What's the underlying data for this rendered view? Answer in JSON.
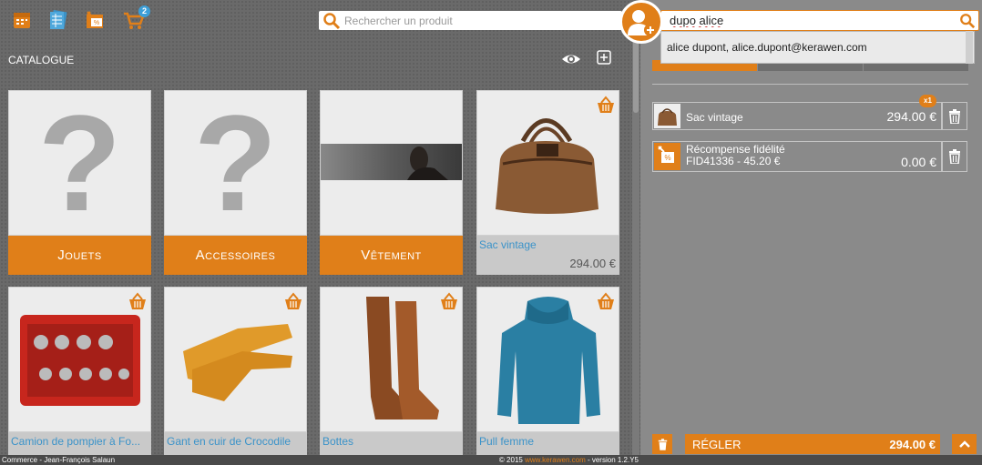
{
  "topbar": {
    "icons": [
      "calendar-icon",
      "catalogue-icon",
      "discount-icon",
      "cart-icon"
    ],
    "cart_badge": "2",
    "search_placeholder": "Rechercher un produit"
  },
  "catalogue": {
    "title": "CATALOGUE",
    "tiles": [
      {
        "kind": "category",
        "label": "Jouets"
      },
      {
        "kind": "category",
        "label": "Accessoires"
      },
      {
        "kind": "category",
        "label": "Vêtement"
      },
      {
        "kind": "product",
        "name": "Sac vintage",
        "price": "294.00 €"
      },
      {
        "kind": "product",
        "name": "Camion de pompier à Fo...",
        "price": ""
      },
      {
        "kind": "product",
        "name": "Gant en cuir de Crocodile",
        "price": ""
      },
      {
        "kind": "product",
        "name": "Bottes",
        "price": ""
      },
      {
        "kind": "product",
        "name": "Pull femme",
        "price": ""
      }
    ]
  },
  "footer": {
    "left": "Commerce - Jean-François Salaun",
    "right_prefix": "© 2015 ",
    "right_link": "www.kerawen.com",
    "right_suffix": " - version 1.2.Y5"
  },
  "customer": {
    "search_value": "dupo alice",
    "suggestion": "alice dupont, alice.dupont@kerawen.com"
  },
  "cart": {
    "lines": [
      {
        "name": "Sac vintage",
        "price": "294.00 €",
        "qty_badge": "x1"
      },
      {
        "name": "Récompense fidélité",
        "sub": "FID41336 - 45.20 €",
        "price": "0.00 €"
      }
    ],
    "pay_label": "RÉGLER",
    "pay_amount": "294.00 €"
  },
  "colors": {
    "accent": "#e07f19",
    "link": "#3b93c9",
    "panel": "#8a8a8a"
  }
}
